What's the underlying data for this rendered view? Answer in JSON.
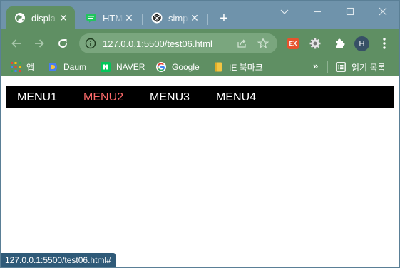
{
  "tabs": [
    {
      "title": "displa",
      "favicon": "globe-icon",
      "active": true
    },
    {
      "title": "HTML",
      "favicon": "chat-bubble-icon",
      "active": false
    },
    {
      "title": "simpl",
      "favicon": "codepen-icon",
      "active": false
    }
  ],
  "tab_close_glyph": "✕",
  "new_tab_glyph": "+",
  "address_bar": {
    "url": "127.0.0.1:5500/test06.html"
  },
  "extensions": {
    "ex_label": "EX",
    "avatar_letter": "H"
  },
  "bookmarks": [
    {
      "label": "앱",
      "icon": "apps-grid-icon"
    },
    {
      "label": "Daum",
      "icon": "daum-icon"
    },
    {
      "label": "NAVER",
      "icon": "naver-icon"
    },
    {
      "label": "Google",
      "icon": "google-icon"
    },
    {
      "label": "IE 북마크",
      "icon": "folder-icon"
    }
  ],
  "bookmarks_more": "»",
  "reading_list_label": "읽기 목록",
  "page": {
    "menu": [
      {
        "label": "MENU1",
        "hovered": false
      },
      {
        "label": "MENU2",
        "hovered": true
      },
      {
        "label": "MENU3",
        "hovered": false
      },
      {
        "label": "MENU4",
        "hovered": false
      }
    ]
  },
  "status_bar": {
    "text": "127.0.0.1:5500/test06.html#"
  },
  "colors": {
    "titlebar": "#6f93ab",
    "toolbar": "#5f8f63",
    "menu_background": "#000000",
    "menu_text": "#ffffff",
    "menu_hover": "#ff6b6b",
    "status_bar": "#2f5a78"
  }
}
